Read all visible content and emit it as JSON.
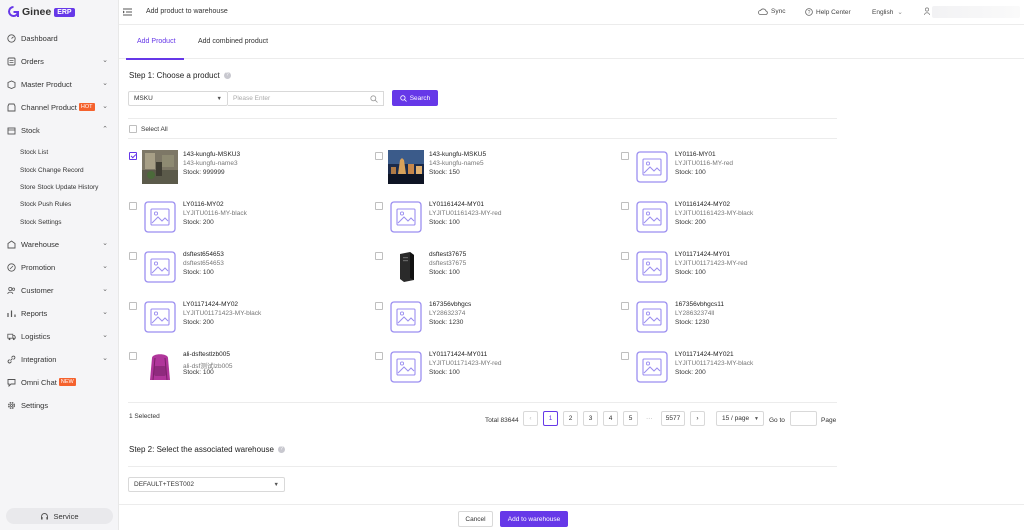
{
  "brand": {
    "name": "Ginee",
    "badge": "ERP"
  },
  "header": {
    "title": "Add product to warehouse",
    "sync": "Sync",
    "help": "Help Center",
    "language": "English"
  },
  "sidebar": {
    "items": [
      {
        "label": "Dashboard",
        "icon": "dashboard-icon"
      },
      {
        "label": "Orders",
        "icon": "orders-icon"
      },
      {
        "label": "Master Product",
        "icon": "box-icon"
      },
      {
        "label": "Channel Product",
        "icon": "store-icon",
        "badge": "HOT"
      },
      {
        "label": "Stock",
        "icon": "stock-icon"
      },
      {
        "label": "Warehouse",
        "icon": "warehouse-icon"
      },
      {
        "label": "Promotion",
        "icon": "promotion-icon"
      },
      {
        "label": "Customer",
        "icon": "customer-icon"
      },
      {
        "label": "Reports",
        "icon": "reports-icon"
      },
      {
        "label": "Logistics",
        "icon": "truck-icon"
      },
      {
        "label": "Integration",
        "icon": "link-icon"
      },
      {
        "label": "Omni Chat",
        "icon": "chat-icon",
        "badge": "NEW"
      },
      {
        "label": "Settings",
        "icon": "gear-icon"
      }
    ],
    "stock_sub": [
      "Stock List",
      "Stock Change Record",
      "Store Stock Update History",
      "Stock Push Rules",
      "Stock Settings"
    ],
    "service": "Service"
  },
  "tabs": [
    "Add Product",
    "Add combined product"
  ],
  "step1": {
    "title": "Step 1: Choose a product",
    "search_type": "MSKU",
    "search_placeholder": "Please Enter",
    "search_button": "Search",
    "select_all": "Select All"
  },
  "products": [
    {
      "name": "143-kungfu-MSKU3",
      "code": "143-kungfu-name3",
      "stock": "Stock: 999999",
      "checked": true,
      "img": "photo-room"
    },
    {
      "name": "143-kungfu-MSKU5",
      "code": "143-kungfu-name5",
      "stock": "Stock: 150",
      "checked": false,
      "img": "photo-city"
    },
    {
      "name": "LY0116-MY01",
      "code": "LYJITU0116-MY-red",
      "stock": "Stock: 100",
      "checked": false,
      "img": "placeholder"
    },
    {
      "name": "LY0116-MY02",
      "code": "LYJITU0116-MY-black",
      "stock": "Stock: 200",
      "checked": false,
      "img": "placeholder"
    },
    {
      "name": "LY01161424-MY01",
      "code": "LYJITU01161423-MY-red",
      "stock": "Stock: 100",
      "checked": false,
      "img": "placeholder"
    },
    {
      "name": "LY01161424-MY02",
      "code": "LYJITU01161423-MY-black",
      "stock": "Stock: 200",
      "checked": false,
      "img": "placeholder"
    },
    {
      "name": "dsftest654653",
      "code": "dsftest654653",
      "stock": "Stock: 100",
      "checked": false,
      "img": "placeholder"
    },
    {
      "name": "dsftest37675",
      "code": "dsftest37675",
      "stock": "Stock: 100",
      "checked": false,
      "img": "photo-pc"
    },
    {
      "name": "LY01171424-MY01",
      "code": "LYJITU01171423-MY-red",
      "stock": "Stock: 100",
      "checked": false,
      "img": "placeholder"
    },
    {
      "name": "LY01171424-MY02",
      "code": "LYJITU01171423-MY-black",
      "stock": "Stock: 200",
      "checked": false,
      "img": "placeholder"
    },
    {
      "name": "167356vbhgcs",
      "code": "LY28632374",
      "stock": "Stock: 1230",
      "checked": false,
      "img": "placeholder"
    },
    {
      "name": "167356vbhgcs11",
      "code": "LY28632374ll",
      "stock": "Stock: 1230",
      "checked": false,
      "img": "placeholder"
    },
    {
      "name": "ali-dsftestlzb005",
      "code": "ali-dsf测试lzb005",
      "stock": "Stock: 100",
      "checked": false,
      "img": "photo-bag"
    },
    {
      "name": "LY01171424-MY011",
      "code": "LYJITU01171423-MY-red",
      "stock": "Stock: 100",
      "checked": false,
      "img": "placeholder"
    },
    {
      "name": "LY01171424-MY021",
      "code": "LYJITU01171423-MY-black",
      "stock": "Stock: 200",
      "checked": false,
      "img": "placeholder"
    }
  ],
  "selection": {
    "count_text": "1 Selected"
  },
  "pagination": {
    "total": "Total 83644",
    "pages": [
      "1",
      "2",
      "3",
      "4",
      "5"
    ],
    "ellipsis": "···",
    "last": "5577",
    "page_size": "15 / page",
    "goto": "Go to",
    "page_word": "Page",
    "current": "1"
  },
  "step2": {
    "title": "Step 2: Select the associated warehouse",
    "warehouse": "DEFAULT+TEST002"
  },
  "footer": {
    "cancel": "Cancel",
    "submit": "Add to warehouse"
  },
  "colors": {
    "accent": "#6638e8",
    "hot": "#f5622d"
  }
}
